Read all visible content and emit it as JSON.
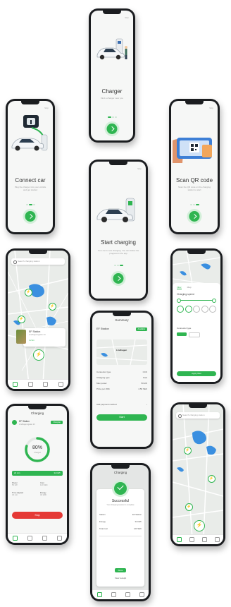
{
  "onboarding": {
    "skip_label": "Skip",
    "charger": {
      "title": "Charger",
      "subtitle": "Find a charger near you"
    },
    "connect": {
      "title": "Connect car",
      "subtitle": "Plug the charger into your vehicle and get started"
    },
    "scan": {
      "title": "Scan QR code",
      "subtitle": "Scan the QR code on the charging station to start"
    },
    "start": {
      "title": "Start charging",
      "subtitle": "Your car is now charging. You can follow the progress in the app"
    }
  },
  "search": {
    "placeholder": "Search charging station"
  },
  "station": {
    "name": "EF Station",
    "address": "Lindhagensgatan 23",
    "distance": "1.2 km",
    "status": "Available"
  },
  "filter": {
    "tabs": [
      "Filter",
      "Map"
    ],
    "heading": "Charging speed",
    "connector_heading": "Connector type",
    "apply_label": "Apply filter"
  },
  "summary": {
    "header": "Summary",
    "station_name": "EF Station",
    "status": "Available",
    "map_label": "Lindhagen",
    "rows": [
      {
        "label": "Connector type",
        "value": "CCS"
      },
      {
        "label": "Charging type",
        "value": "Fast"
      },
      {
        "label": "Max power",
        "value": "50 kW"
      },
      {
        "label": "Price per kWh",
        "value": "4.50 SEK"
      }
    ],
    "payment_label": "Add payment method",
    "start_label": "Start"
  },
  "charging": {
    "header": "Charging",
    "station_name": "EF Station",
    "station_address": "Lindhagensgatan 23",
    "status": "Charging",
    "percent_text": "80%",
    "percent_sub": "Charged",
    "progress": 0.8,
    "time_left": "24 min",
    "kwh": "32 kWh",
    "stats": [
      {
        "label": "Power",
        "value": "50 kW"
      },
      {
        "label": "Cost",
        "value": "120 SEK"
      },
      {
        "label": "Time elapsed",
        "value": "40 min"
      },
      {
        "label": "Energy",
        "value": "32 kWh"
      }
    ],
    "stop_label": "Stop"
  },
  "success": {
    "header": "Charging",
    "title": "Successful",
    "subtitle": "Your charging session is complete",
    "rows": [
      {
        "label": "Station",
        "value": "EF Station"
      },
      {
        "label": "Energy",
        "value": "32 kWh"
      },
      {
        "label": "Total cost",
        "value": "120 SEK"
      }
    ],
    "done_label": "Done",
    "receipt_label": "View receipt"
  },
  "colors": {
    "accent": "#2fb551",
    "stop": "#e53935",
    "phone": "#1b1d20"
  }
}
